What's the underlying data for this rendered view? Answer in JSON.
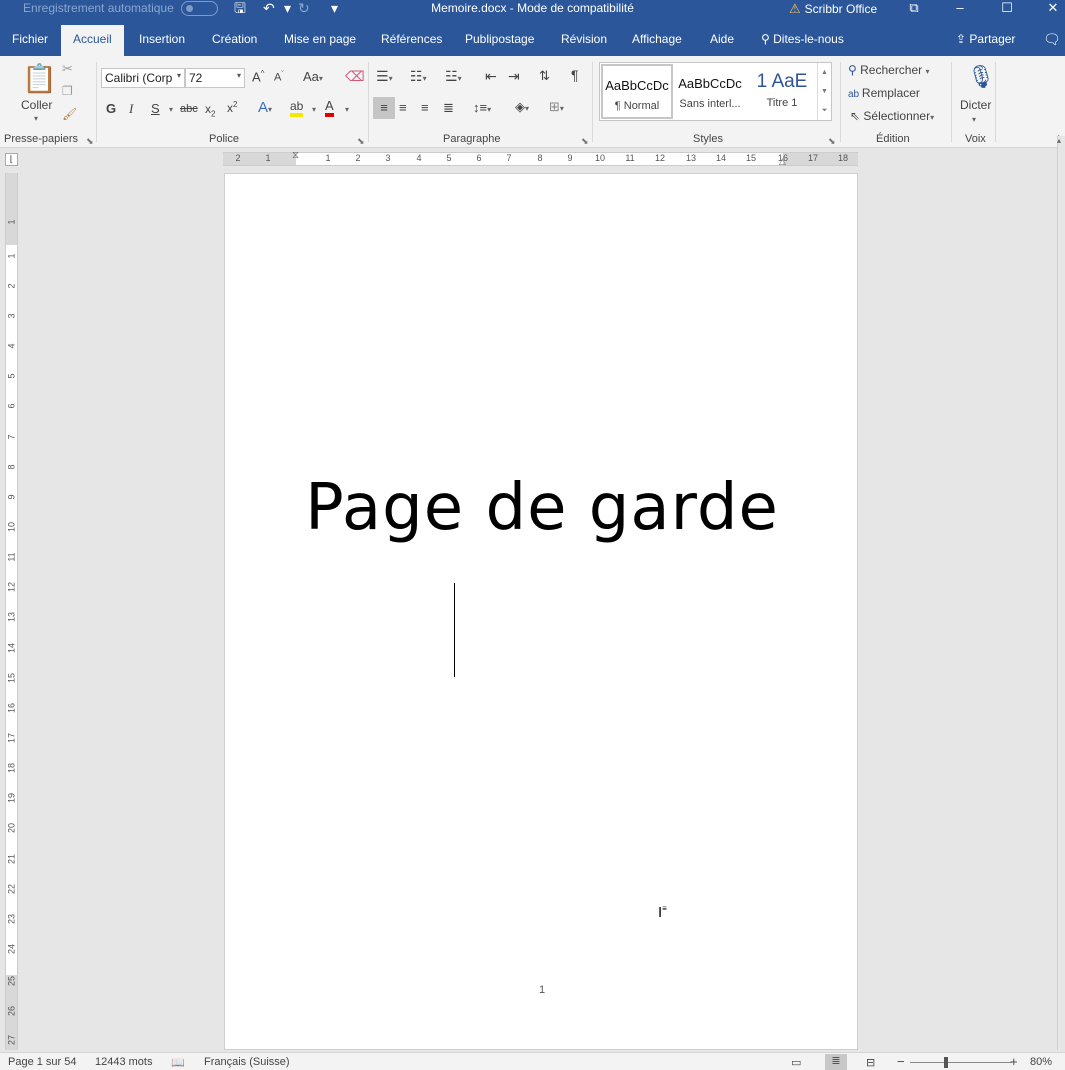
{
  "titlebar": {
    "autosave_label": "Enregistrement automatique",
    "document_title": "Memoire.docx  -  Mode de compatibilité",
    "addin": "Scribbr Office"
  },
  "tabs": [
    "Fichier",
    "Accueil",
    "Insertion",
    "Création",
    "Mise en page",
    "Références",
    "Publipostage",
    "Révision",
    "Affichage",
    "Aide"
  ],
  "tell_me": "Dites-le-nous",
  "share": "Partager",
  "ribbon": {
    "clipboard": {
      "paste": "Coller",
      "label": "Presse-papiers"
    },
    "font": {
      "name": "Calibri (Corp",
      "size": "72",
      "label": "Police",
      "bold": "G",
      "italic": "I",
      "underline": "S",
      "strike": "abc"
    },
    "paragraph": {
      "label": "Paragraphe"
    },
    "styles": {
      "label": "Styles",
      "items": [
        {
          "preview": "AaBbCcDc",
          "name": "¶ Normal"
        },
        {
          "preview": "AaBbCcDc",
          "name": "Sans interl..."
        },
        {
          "preview": "1  AaE",
          "name": "Titre 1"
        }
      ]
    },
    "editing": {
      "find": "Rechercher",
      "replace": "Remplacer",
      "select": "Sélectionner",
      "label": "Édition"
    },
    "voice": {
      "dictate": "Dicter",
      "label": "Voix"
    }
  },
  "ruler": {
    "h_left": [
      "2",
      "1"
    ],
    "h_right": [
      "1",
      "2",
      "3",
      "4",
      "5",
      "6",
      "7",
      "8",
      "9",
      "10",
      "11",
      "12",
      "13",
      "14",
      "15",
      "16",
      "17",
      "18"
    ],
    "v_top": [
      "1"
    ],
    "v_body": [
      "1",
      "2",
      "3",
      "4",
      "5",
      "6",
      "7",
      "8",
      "9",
      "10",
      "11",
      "12",
      "13",
      "14",
      "15",
      "16",
      "17",
      "18",
      "19",
      "20",
      "21",
      "22",
      "23",
      "24",
      "25",
      "26",
      "27"
    ]
  },
  "document": {
    "heading": "Page de garde",
    "page_number": "1"
  },
  "status": {
    "page": "Page 1 sur 54",
    "words": "12443 mots",
    "language": "Français (Suisse)",
    "zoom": "80%",
    "zoom_level_percent": 80
  }
}
